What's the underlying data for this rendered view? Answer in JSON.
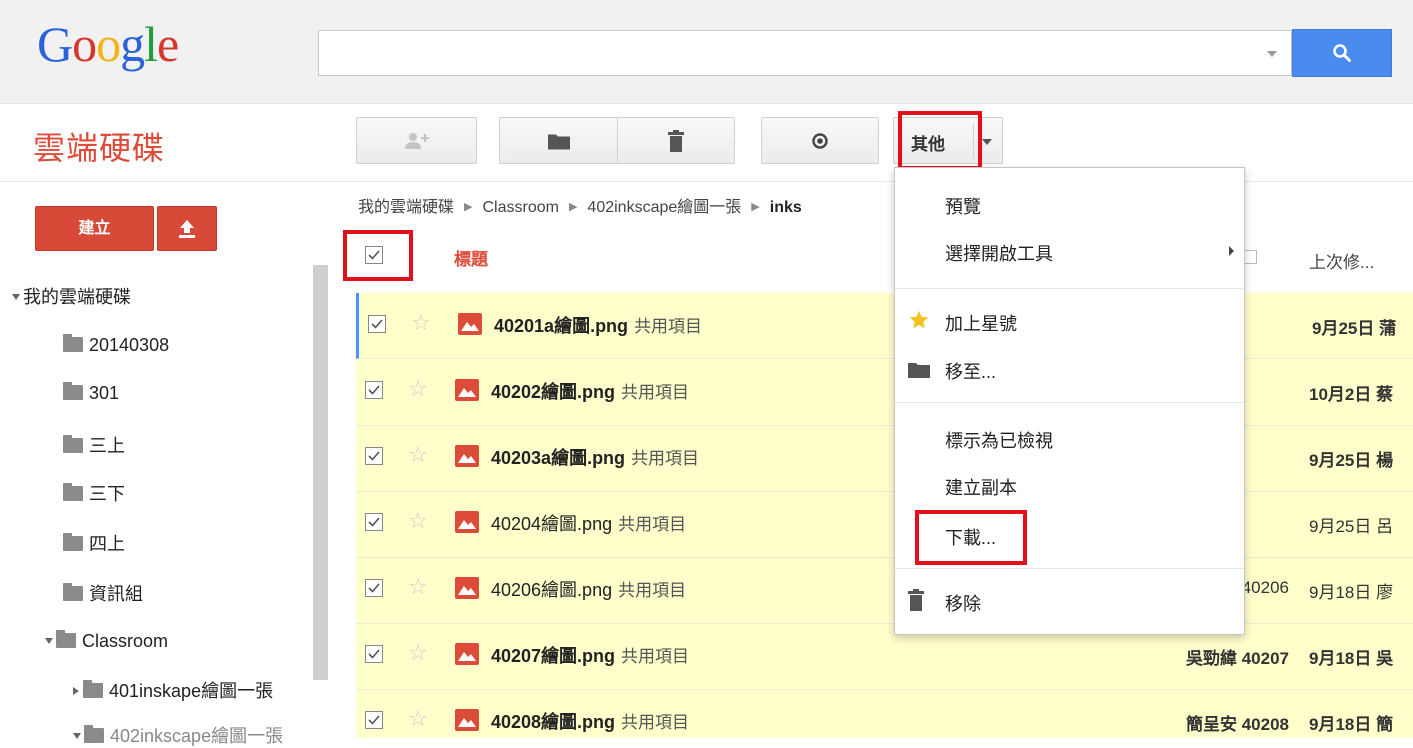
{
  "header": {
    "logo_letters": [
      "G",
      "o",
      "o",
      "g",
      "l",
      "e"
    ],
    "search_placeholder": ""
  },
  "app": {
    "title": "雲端硬碟"
  },
  "toolbar": {
    "more_label": "其他"
  },
  "sidebar": {
    "create_label": "建立",
    "tree": [
      {
        "label": "我的雲端硬碟",
        "type": "root"
      },
      {
        "label": "20140308",
        "type": "folder"
      },
      {
        "label": "301",
        "type": "folder"
      },
      {
        "label": "三上",
        "type": "folder"
      },
      {
        "label": "三下",
        "type": "folder"
      },
      {
        "label": "四上",
        "type": "folder"
      },
      {
        "label": "資訊組",
        "type": "folder"
      },
      {
        "label": "Classroom",
        "type": "folder-expanded"
      },
      {
        "label": "401inskape繪圖一張",
        "type": "folder-collapsed"
      },
      {
        "label": "402inkscape繪圖一張",
        "type": "folder-expanded"
      }
    ]
  },
  "breadcrumb": {
    "items": [
      "我的雲端硬碟",
      "Classroom",
      "402inkscape繪圖一張",
      "inks"
    ]
  },
  "list": {
    "col_title": "標題",
    "col_modified": "上次修...",
    "shared_label": "共用項目",
    "rows": [
      {
        "name": "40201a繪圖.png",
        "owner": "",
        "date": "9月25日",
        "trail": "蒲",
        "bold": true
      },
      {
        "name": "40202繪圖.png",
        "owner": "",
        "date": "10月2日",
        "trail": "蔡",
        "bold": true
      },
      {
        "name": "40203a繪圖.png",
        "owner": "",
        "date": "9月25日",
        "trail": "楊",
        "bold": true
      },
      {
        "name": "40204繪圖.png",
        "owner": "",
        "date": "9月25日",
        "trail": "呂",
        "bold": false
      },
      {
        "name": "40206繪圖.png",
        "owner": "40206",
        "date": "9月18日",
        "trail": "廖",
        "bold": false
      },
      {
        "name": "40207繪圖.png",
        "owner": "吳勁緯 40207",
        "date": "9月18日",
        "trail": "吳",
        "bold": true
      },
      {
        "name": "40208繪圖.png",
        "owner": "簡呈安 40208",
        "date": "9月18日",
        "trail": "簡",
        "bold": true
      }
    ]
  },
  "menu": {
    "items": {
      "preview": "預覽",
      "open_with": "選擇開啟工具",
      "add_star": "加上星號",
      "move_to": "移至...",
      "mark_viewed": "標示為已檢視",
      "make_copy": "建立副本",
      "download": "下載...",
      "remove": "移除"
    }
  },
  "colors": {
    "accent_red": "#dd4b39",
    "search_blue": "#4a8bf0",
    "selected_row": "#ffffcc",
    "highlight_box": "#e3101c"
  }
}
